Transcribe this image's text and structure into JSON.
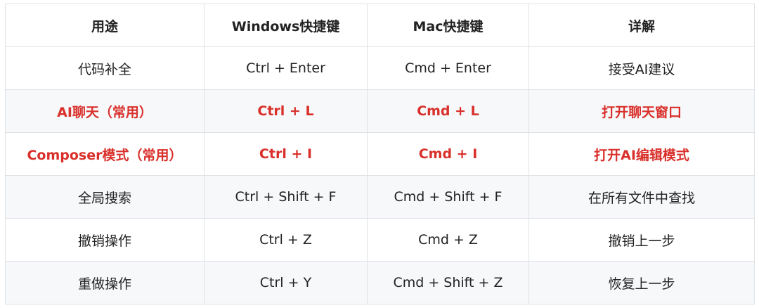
{
  "table": {
    "headers": [
      "用途",
      "Windows快捷键",
      "Mac快捷键",
      "详解"
    ],
    "rows": [
      {
        "cells": [
          "代码补全",
          "Ctrl + Enter",
          "Cmd + Enter",
          "接受AI建议"
        ],
        "highlight": false
      },
      {
        "cells": [
          "AI聊天（常用）",
          "Ctrl + L",
          "Cmd + L",
          "打开聊天窗口"
        ],
        "highlight": true
      },
      {
        "cells": [
          "Composer模式（常用）",
          "Ctrl + I",
          "Cmd + I",
          "打开AI编辑模式"
        ],
        "highlight": true
      },
      {
        "cells": [
          "全局搜索",
          "Ctrl + Shift + F",
          "Cmd + Shift + F",
          "在所有文件中查找"
        ],
        "highlight": false
      },
      {
        "cells": [
          "撤销操作",
          "Ctrl + Z",
          "Cmd + Z",
          "撤销上一步"
        ],
        "highlight": false
      },
      {
        "cells": [
          "重做操作",
          "Ctrl + Y",
          "Cmd + Shift + Z",
          "恢复上一步"
        ],
        "highlight": false
      }
    ]
  },
  "colors": {
    "highlight_text": "#d9302b",
    "border": "#dfe2e5",
    "alt_row_bg": "#f6f8fa",
    "text": "#222222"
  }
}
